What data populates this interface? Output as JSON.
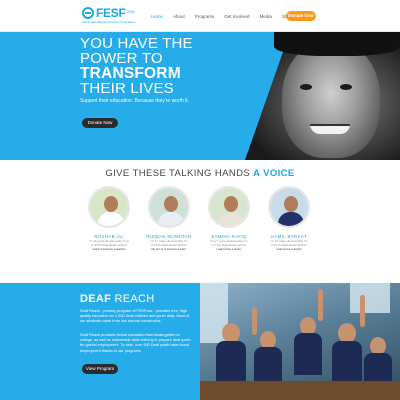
{
  "brand": {
    "logo_text": "FESF",
    "logo_sup": "USA",
    "tagline": "Family Educational Services Foundation"
  },
  "nav": {
    "items": [
      {
        "label": "Home",
        "active": true
      },
      {
        "label": "About",
        "active": false
      },
      {
        "label": "Programs",
        "active": false
      },
      {
        "label": "Get Involved",
        "active": false
      },
      {
        "label": "Media",
        "active": false
      },
      {
        "label": "Shop",
        "active": false
      }
    ],
    "donate_label": "Donate Now"
  },
  "hero": {
    "line1": "YOU HAVE THE",
    "line2": "POWER TO",
    "line3": "TRANSFORM",
    "line4": "THEIR LIVES",
    "subtext": "Support their education. Because they're worth it.",
    "button_label": "Donate Now"
  },
  "voice": {
    "title_prefix": "GIVE THESE TALKING HANDS",
    "title_highlight": "A VOICE",
    "people": [
      {
        "name": "NOSHAB ALI",
        "line1": "I'm 19 years old and today I'm in",
        "line2": "11 at the Deaf Reach School.",
        "line3": "I want to become a teacher.",
        "bg": "#d8e6c8",
        "body": "#ffffff"
      },
      {
        "name": "RIZWAN MUNNTAR",
        "line1": "I'm 17 years old and today I'm",
        "line2": "in at the Deaf Reach School.",
        "line3": "My aim is to become a tutor.",
        "bg": "#cfe0d6",
        "body": "#e9eef2"
      },
      {
        "name": "SAMINA RAFIQ",
        "line1": "I'm 17 years old and today I'm",
        "line2": "in at the Deaf Reach School.",
        "line3": "I want to be a nurse.",
        "bg": "#d7e4cf",
        "body": "#e8e2d8"
      },
      {
        "name": "KAMIL BARKAT",
        "line1": "I'm 15 years old and today I'm",
        "line2": "in at the Deaf Reach School.",
        "line3": "I want to be a doctor.",
        "bg": "#c9dbe9",
        "body": "#23316b"
      }
    ]
  },
  "deaf_reach": {
    "title_bold": "DEAF",
    "title_rest": "REACH",
    "para1": "Deaf Reach - primary program of FESFusa - provides free, high quality education for 1,500 Deaf children and youth daily. Most of our students come from low income households.",
    "para2": "Deaf Reach provides formal education from kindergarten to college, as well as marketable skills training to prepare deaf youth for gainful employment. To date, over 600 Deaf youth have found employment thanks to our programs.",
    "button_label": "View Program"
  },
  "colors": {
    "primary": "#27acea",
    "accent": "#f59a1b",
    "dark_button": "#2b2b2b"
  }
}
